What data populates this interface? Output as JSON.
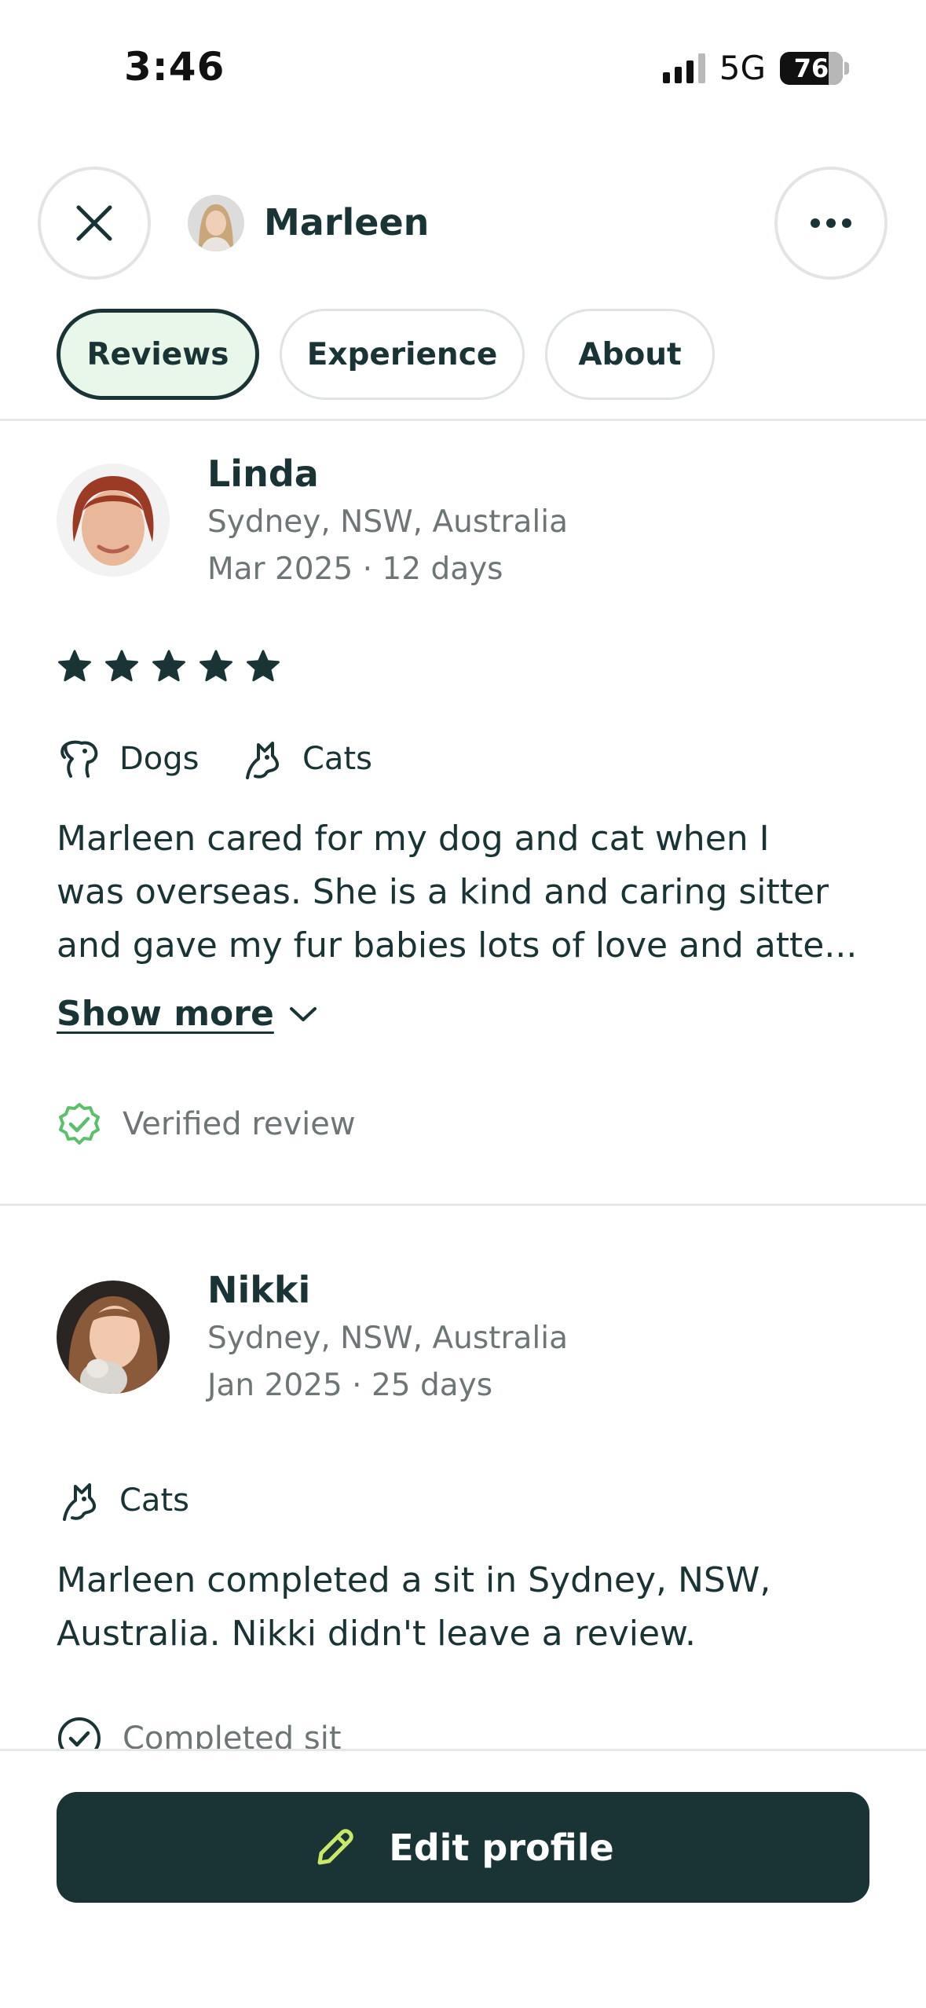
{
  "status_bar": {
    "time": "3:46",
    "network": "5G",
    "battery": "76"
  },
  "header": {
    "name": "Marleen",
    "close_icon": "close-icon",
    "more_icon": "more-horizontal-icon"
  },
  "tabs": [
    {
      "label": "Reviews",
      "active": true
    },
    {
      "label": "Experience",
      "active": false
    },
    {
      "label": "About",
      "active": false
    }
  ],
  "reviews": [
    {
      "name": "Linda",
      "location": "Sydney, NSW, Australia",
      "date_duration": "Mar 2025 · 12 days",
      "rating": 5,
      "pets": [
        "Dogs",
        "Cats"
      ],
      "text_lines": [
        "Marleen cared for my dog and cat when I",
        "was overseas. She is a kind and caring sitter",
        "and gave my fur babies lots of love and atte..."
      ],
      "show_more": "Show more",
      "badge": "Verified review"
    },
    {
      "name": "Nikki",
      "location": "Sydney, NSW, Australia",
      "date_duration": "Jan 2025 · 25 days",
      "pets": [
        "Cats"
      ],
      "text_lines": [
        "Marleen completed a sit in Sydney, NSW,",
        "Australia. Nikki didn't leave a review."
      ],
      "badge": "Completed sit"
    }
  ],
  "footer": {
    "edit_label": "Edit profile"
  },
  "colors": {
    "primary": "#1a3435",
    "accent_green": "#5cc06b",
    "tab_active_bg": "#e8f7e9",
    "pencil": "#c8e86a",
    "muted_text": "#6e7576"
  }
}
